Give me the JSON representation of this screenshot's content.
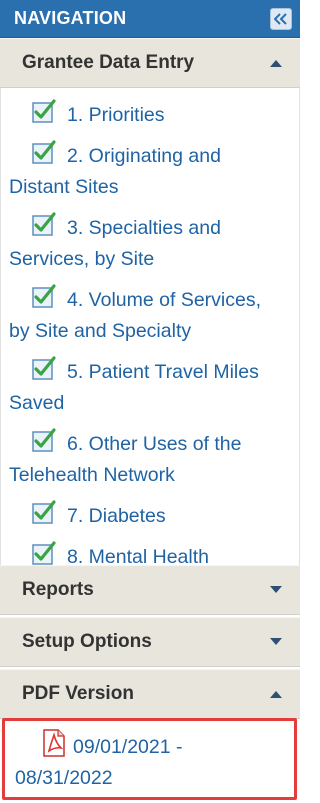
{
  "header": {
    "title": "NAVIGATION"
  },
  "sections": {
    "grantee": {
      "label": "Grantee Data Entry"
    },
    "reports": {
      "label": "Reports"
    },
    "setup": {
      "label": "Setup Options"
    },
    "pdf": {
      "label": "PDF Version"
    }
  },
  "grantee_items": [
    {
      "first": "1. Priorities",
      "rest": ""
    },
    {
      "first": "2. Originating and",
      "rest": "Distant Sites"
    },
    {
      "first": "3. Specialties and",
      "rest": "Services, by Site"
    },
    {
      "first": "4. Volume of Services,",
      "rest": "by Site and Specialty"
    },
    {
      "first": "5. Patient Travel Miles",
      "rest": "Saved"
    },
    {
      "first": "6. Other Uses of the",
      "rest": "Telehealth Network"
    },
    {
      "first": "7. Diabetes",
      "rest": ""
    },
    {
      "first": "8. Mental Health",
      "rest": ""
    }
  ],
  "pdf_version": {
    "first": "09/01/2021 -",
    "rest": "08/31/2022"
  },
  "icons": {
    "collapse": "double-chevron-left-icon",
    "caret_up": "caret-up-icon",
    "caret_down": "caret-down-icon",
    "check": "checkbox-checked-icon",
    "pdf": "pdf-file-icon"
  },
  "colors": {
    "header": "#2a6fae",
    "link": "#1f63a5",
    "section": "#e7e5dc",
    "highlight": "#e43b3b"
  }
}
